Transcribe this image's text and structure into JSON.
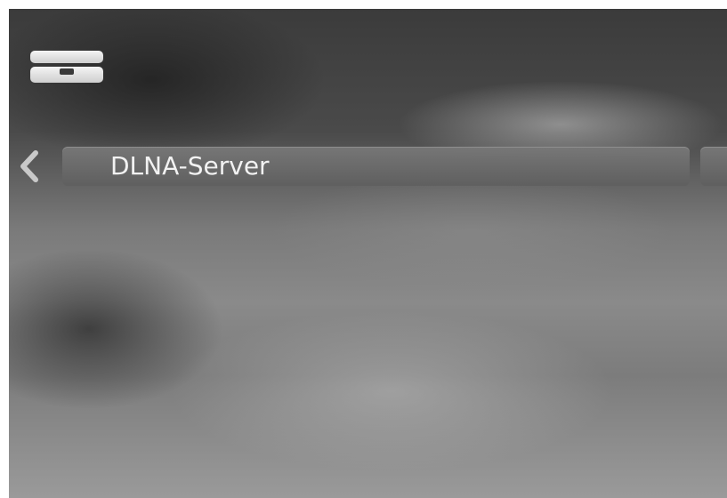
{
  "header": {
    "device_icon": "network-drive-icon"
  },
  "nav": {
    "back_icon": "chevron-left-icon",
    "title": "DLNA-Server"
  },
  "colors": {
    "background_dark": "#3b3b3b",
    "background_light": "#9a9a9a",
    "pill": "#6f6f6f",
    "text": "#f2f2f2"
  }
}
